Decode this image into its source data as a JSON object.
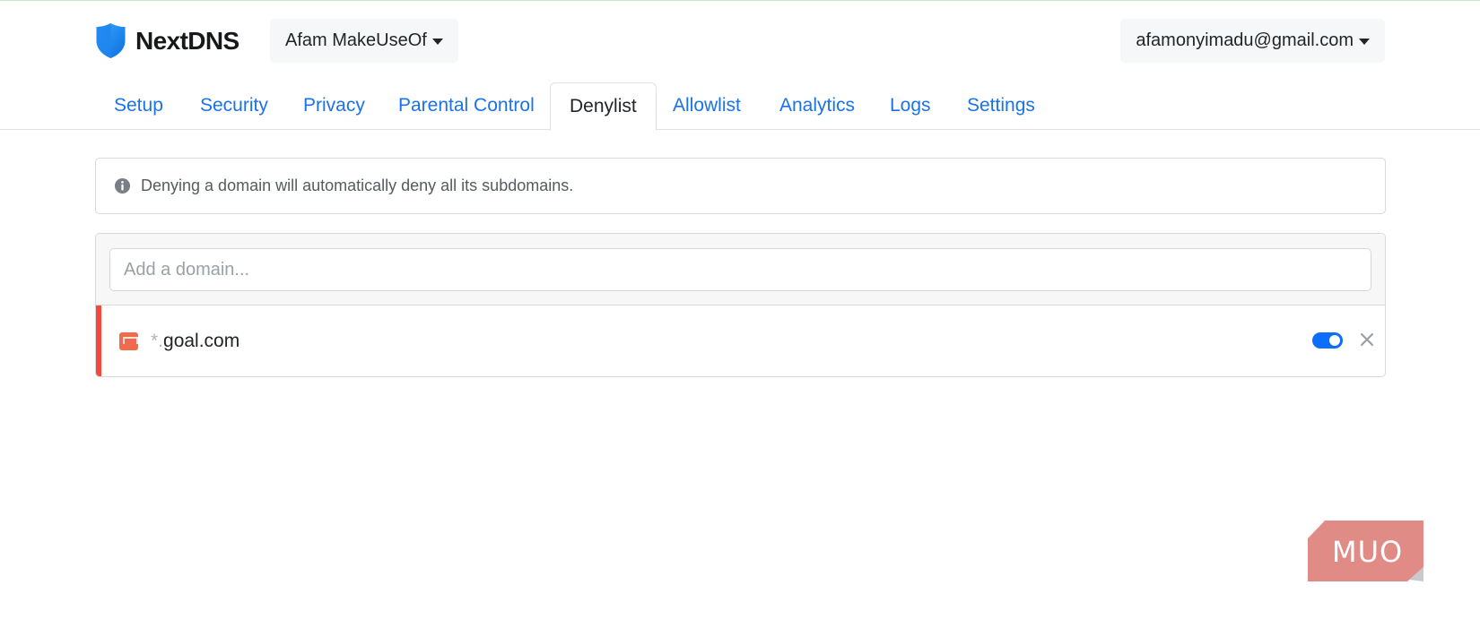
{
  "header": {
    "brand": "NextDNS",
    "profile": "Afam MakeUseOf",
    "account": "afamonyimadu@gmail.com"
  },
  "tabs": [
    {
      "label": "Setup"
    },
    {
      "label": "Security"
    },
    {
      "label": "Privacy"
    },
    {
      "label": "Parental Control"
    },
    {
      "label": "Denylist"
    },
    {
      "label": "Allowlist"
    },
    {
      "label": "Analytics"
    },
    {
      "label": "Logs"
    },
    {
      "label": "Settings"
    }
  ],
  "active_tab": "Denylist",
  "info": {
    "icon": "info-icon",
    "text": "Denying a domain will automatically deny all its subdomains."
  },
  "denylist": {
    "input_placeholder": "Add a domain...",
    "input_value": "",
    "entries": [
      {
        "wildcard": "*.",
        "domain": "goal.com",
        "enabled": true
      }
    ]
  },
  "watermark": {
    "text": "MUO"
  },
  "colors": {
    "accent": "#1a73e8",
    "toggle_on": "#0d6efd",
    "deny_bar": "#f4493c",
    "brand_shield": "#1b8cf2",
    "watermark": "#e08b86"
  }
}
